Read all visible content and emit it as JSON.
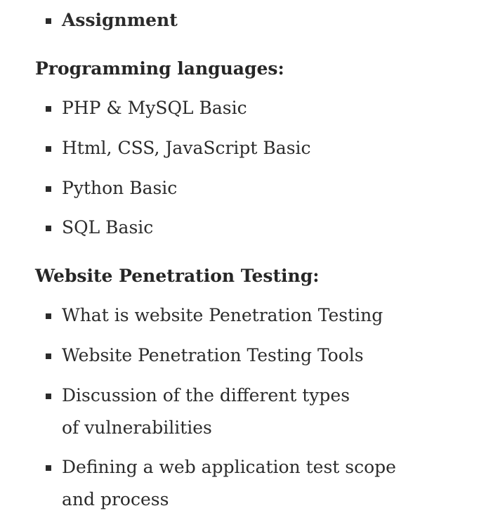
{
  "top_item": "Assignment",
  "sections": [
    {
      "heading": "Programming languages:",
      "items": [
        "PHP & MySQL Basic",
        "Html, CSS, JavaScript Basic",
        "Python Basic",
        "SQL Basic"
      ]
    },
    {
      "heading": "Website Penetration Testing:",
      "items": [
        "What is website Penetration Testing",
        "Website Penetration Testing Tools",
        "Discussion of the different types of vulnerabilities",
        "Defining a web application test scope and process"
      ]
    }
  ]
}
